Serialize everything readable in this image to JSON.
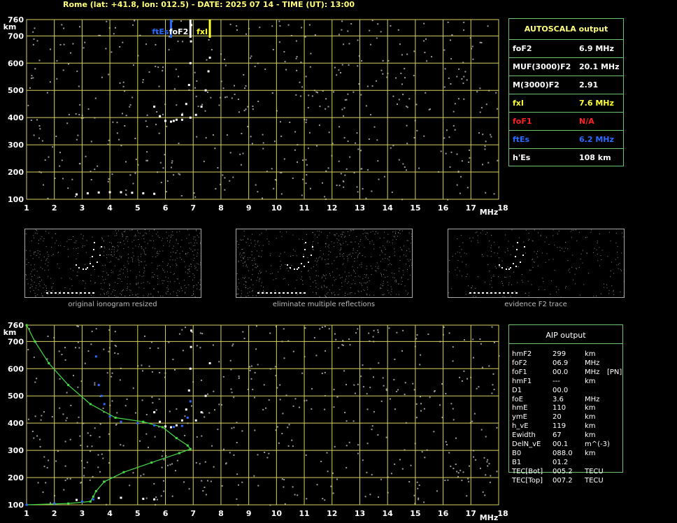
{
  "header": "Rome (lat: +41.8, lon: 012.5) - DATE: 2025 07 14 - TIME (UT): 13:00",
  "colors": {
    "grid": "#d8d060",
    "green": "#44dd44",
    "blue": "#2a6bff",
    "yellow": "#ffff33",
    "red": "#ff2222",
    "dots": "#9a9a9a"
  },
  "chart_data": [
    {
      "type": "scatter",
      "title": "",
      "xlabel": "MHz",
      "ylabel": "km",
      "xlim": [
        1,
        18
      ],
      "ylim": [
        100,
        760
      ],
      "grid": true,
      "x_ticks": [
        "1",
        "2",
        "3",
        "4",
        "5",
        "6",
        "7",
        "8",
        "9",
        "10",
        "11",
        "12",
        "13",
        "14",
        "15",
        "16",
        "17",
        "18"
      ],
      "y_ticks": [
        "100",
        "200",
        "300",
        "400",
        "500",
        "600",
        "700",
        "760"
      ],
      "series": [
        {
          "name": "",
          "color": "#ffffff",
          "x": [
            5.6,
            5.8,
            6.0,
            6.2,
            6.4,
            6.6,
            6.75,
            6.85,
            6.9,
            6.92,
            6.93
          ],
          "y": [
            440,
            405,
            388,
            385,
            392,
            410,
            450,
            520,
            600,
            680,
            740
          ]
        },
        {
          "name": "",
          "color": "#ffffff",
          "x": [
            6.3,
            6.6,
            6.9,
            7.1,
            7.3,
            7.45,
            7.55,
            7.6
          ],
          "y": [
            388,
            392,
            400,
            410,
            440,
            500,
            570,
            620
          ]
        },
        {
          "name": "",
          "color": "#ffffff",
          "x": [
            2.8,
            3.2,
            3.6,
            4.0,
            4.4,
            4.8,
            5.2,
            5.6
          ],
          "y": [
            118,
            122,
            125,
            126,
            126,
            124,
            122,
            120
          ]
        }
      ],
      "markers": [
        {
          "label": "ftEs",
          "x": 6.2,
          "color": "#2a6bff"
        },
        {
          "label": "foF2",
          "x": 6.9,
          "color": "#ffffff"
        },
        {
          "label": "fxI",
          "x": 7.6,
          "color": "#ffff33"
        }
      ]
    },
    {
      "type": "line",
      "title": "",
      "xlabel": "MHz",
      "ylabel": "km",
      "xlim": [
        1,
        18
      ],
      "ylim": [
        100,
        760
      ],
      "grid": true,
      "x_ticks": [
        "1",
        "2",
        "3",
        "4",
        "5",
        "6",
        "7",
        "8",
        "9",
        "10",
        "11",
        "12",
        "13",
        "14",
        "15",
        "16",
        "17",
        "18"
      ],
      "y_ticks": [
        "100",
        "200",
        "300",
        "400",
        "500",
        "600",
        "700",
        "760"
      ],
      "series": [
        {
          "name": "",
          "color": "#44dd44",
          "x": [
            1.0,
            1.3,
            1.8,
            2.5,
            3.3,
            4.2,
            5.2,
            5.9,
            6.4,
            6.8,
            6.9,
            6.5,
            5.5,
            4.5,
            3.8,
            3.5,
            3.4,
            3.3,
            2.5,
            1.0
          ],
          "y": [
            760,
            700,
            620,
            540,
            470,
            420,
            405,
            385,
            345,
            318,
            305,
            290,
            255,
            220,
            185,
            150,
            130,
            112,
            105,
            100
          ]
        },
        {
          "name": "",
          "color": "#2a6bff",
          "x": [
            3.5,
            3.6,
            3.7,
            3.8,
            4.0,
            4.4,
            5.0,
            5.6,
            6.0,
            6.3,
            6.6,
            6.8,
            6.9,
            1.0,
            2.0,
            3.0,
            3.4
          ],
          "y": [
            645,
            540,
            500,
            470,
            425,
            405,
            400,
            392,
            388,
            386,
            390,
            420,
            480,
            100,
            105,
            112,
            120
          ]
        },
        {
          "name": "",
          "color": "#ffffff",
          "x": [
            5.6,
            5.8,
            6.0,
            6.2,
            6.4,
            6.6,
            6.75,
            6.85,
            6.9,
            6.92,
            6.93,
            7.1,
            7.3,
            7.45,
            7.6,
            2.8,
            3.6,
            4.4,
            5.2,
            5.6
          ],
          "y": [
            440,
            405,
            388,
            385,
            392,
            410,
            450,
            520,
            600,
            680,
            740,
            410,
            440,
            500,
            620,
            118,
            125,
            126,
            122,
            120
          ]
        }
      ]
    }
  ],
  "autoscala": {
    "title": "AUTOSCALA output",
    "rows": [
      {
        "key": "foF2",
        "value": "6.9 MHz",
        "color": "#ffffff"
      },
      {
        "key": "MUF(3000)F2",
        "value": "20.1 MHz",
        "color": "#ffffff"
      },
      {
        "key": "M(3000)F2",
        "value": "2.91",
        "color": "#ffffff"
      },
      {
        "key": "fxI",
        "value": "7.6 MHz",
        "color": "#ffff33"
      },
      {
        "key": "foF1",
        "value": "N/A",
        "color": "#ff2222"
      },
      {
        "key": "ftEs",
        "value": "6.2 MHz",
        "color": "#2a6bff"
      },
      {
        "key": "h'Es",
        "value": "108    km",
        "color": "#ffffff"
      }
    ]
  },
  "aip": {
    "title": "AIP output",
    "rows": [
      {
        "key": "hmF2",
        "val": "299",
        "unit": "km",
        "extra": ""
      },
      {
        "key": "foF2",
        "val": "06.9",
        "unit": "MHz",
        "extra": ""
      },
      {
        "key": "foF1",
        "val": "00.0",
        "unit": "MHz",
        "extra": "[PN]"
      },
      {
        "key": "hmF1",
        "val": "---",
        "unit": "km",
        "extra": ""
      },
      {
        "key": "D1",
        "val": "00.0",
        "unit": "",
        "extra": ""
      },
      {
        "key": "foE",
        "val": "3.6",
        "unit": "MHz",
        "extra": ""
      },
      {
        "key": "hmE",
        "val": "110",
        "unit": "km",
        "extra": ""
      },
      {
        "key": "ymE",
        "val": "20",
        "unit": "km",
        "extra": ""
      },
      {
        "key": "h_vE",
        "val": "119",
        "unit": "km",
        "extra": ""
      },
      {
        "key": "Ewidth",
        "val": "67",
        "unit": "km",
        "extra": ""
      },
      {
        "key": "DelN_vE",
        "val": "00.1",
        "unit": "m^(-3)",
        "extra": ""
      },
      {
        "key": "B0",
        "val": "088.0",
        "unit": "km",
        "extra": ""
      },
      {
        "key": "B1",
        "val": "01.2",
        "unit": "",
        "extra": ""
      },
      {
        "key": "TEC[Bot]",
        "val": "005.2",
        "unit": "TECU",
        "extra": ""
      },
      {
        "key": "TEC[Top]",
        "val": "007.2",
        "unit": "TECU",
        "extra": ""
      }
    ]
  },
  "thumbnails": [
    {
      "caption": "original ionogram resized"
    },
    {
      "caption": "eliminate multiple reflections"
    },
    {
      "caption": "evidence F2 trace"
    }
  ]
}
